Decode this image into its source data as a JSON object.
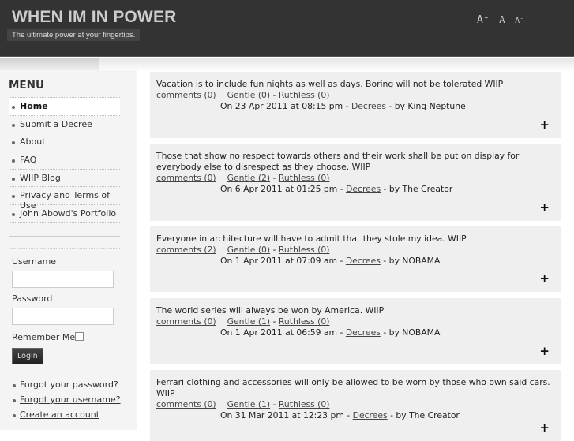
{
  "header": {
    "title": "WHEN IM IN POWER",
    "tagline": "The ultimate power at your fingertips.",
    "font_increase": "A⁺",
    "font_reset": "A",
    "font_decrease": "A⁻"
  },
  "sidebar": {
    "menu_title": "MENU",
    "menu": [
      {
        "label": "Home"
      },
      {
        "label": "Submit a Decree"
      },
      {
        "label": "About"
      },
      {
        "label": "FAQ"
      },
      {
        "label": "WIIP Blog"
      },
      {
        "label": "Privacy and Terms of Use"
      },
      {
        "label": "John Abowd's Portfolio"
      }
    ],
    "login": {
      "username_label": "Username",
      "username_value": "",
      "password_label": "Password",
      "password_value": "",
      "remember_label": "Remember Me",
      "login_button": "Login",
      "links": [
        "Forgot your password?",
        "Forgot your username?",
        "Create an account"
      ]
    }
  },
  "posts": [
    {
      "text": "Vacation is to include fun nights as well as days. Boring will not be tolerated WIIP",
      "comments": "comments (0)",
      "gentle": "Gentle (0)",
      "ruthless": "Ruthless (0)",
      "date": "On 23 Apr 2011 at 08:15 pm - ",
      "category": "Decrees",
      "author": " - by King Neptune"
    },
    {
      "text": "Those that show no respect towards others and their work shall be put on display for everybody else to disrespect as they choose. WIIP",
      "comments": "comments (0)",
      "gentle": "Gentle (2)",
      "ruthless": "Ruthless (0)",
      "date": "On 6 Apr 2011 at 01:25 pm - ",
      "category": "Decrees",
      "author": " - by The Creator"
    },
    {
      "text": "Everyone in architecture will have to admit that they stole my idea. WIIP",
      "comments": "comments (2)",
      "gentle": "Gentle (0)",
      "ruthless": "Ruthless (0)",
      "date": "On 1 Apr 2011 at 07:09 am - ",
      "category": "Decrees",
      "author": " - by NOBAMA"
    },
    {
      "text": "The world series will always be won by America. WIIP",
      "comments": "comments (0)",
      "gentle": "Gentle (1)",
      "ruthless": "Ruthless (0)",
      "date": "On 1 Apr 2011 at 06:59 am - ",
      "category": "Decrees",
      "author": " - by NOBAMA"
    },
    {
      "text": "Ferrari clothing and accessories will only be allowed to be worn by those who own said cars. WIIP",
      "comments": "comments (0)",
      "gentle": "Gentle (1)",
      "ruthless": "Ruthless (0)",
      "date": "On 31 Mar 2011 at 12:23 pm - ",
      "category": "Decrees",
      "author": " - by The Creator"
    }
  ],
  "expand_symbol": "+",
  "sep": " - "
}
